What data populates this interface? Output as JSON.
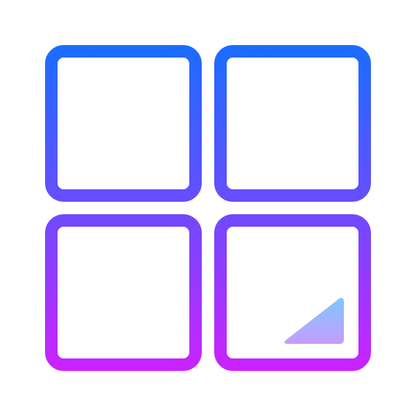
{
  "icon": {
    "name": "grid-tiles-icon",
    "tiles": [
      {
        "name": "tile-top-left"
      },
      {
        "name": "tile-top-right"
      },
      {
        "name": "tile-bottom-left"
      },
      {
        "name": "tile-bottom-right"
      }
    ],
    "accent_triangle": "corner-triangle-icon"
  },
  "colors": {
    "gradient_top": "#1a6dff",
    "gradient_mid": "#6a4cff",
    "gradient_bottom": "#cc22ff",
    "triangle_top": "#7cc8ff",
    "triangle_bottom": "#c79cff",
    "background": "#ffffff"
  }
}
